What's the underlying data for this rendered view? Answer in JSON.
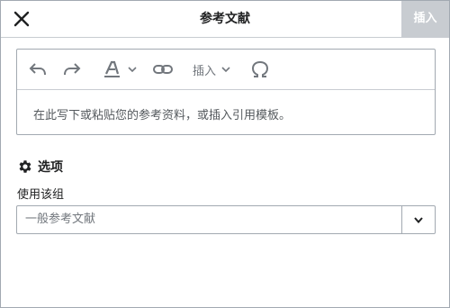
{
  "dialog": {
    "title": "参考文献",
    "insert_label": "插入",
    "close_icon": "close-icon"
  },
  "toolbar": {
    "undo_icon": "undo-icon",
    "redo_icon": "redo-icon",
    "text_style_icon": "text-style-icon",
    "link_icon": "link-icon",
    "insert_label": "插入",
    "special_char_icon": "omega-icon"
  },
  "editor": {
    "placeholder": "在此写下或粘贴您的参考资料，或插入引用模板。"
  },
  "options": {
    "heading": "选项",
    "icon": "gear-icon",
    "use_group_label": "使用该组",
    "group_select": {
      "selected": "一般参考文献"
    }
  },
  "colors": {
    "border": "#a2a9b1",
    "divider": "#c8ccd1",
    "disabled_button_bg": "#c8ccd1",
    "icon_gray": "#72777d",
    "text": "#202122"
  }
}
